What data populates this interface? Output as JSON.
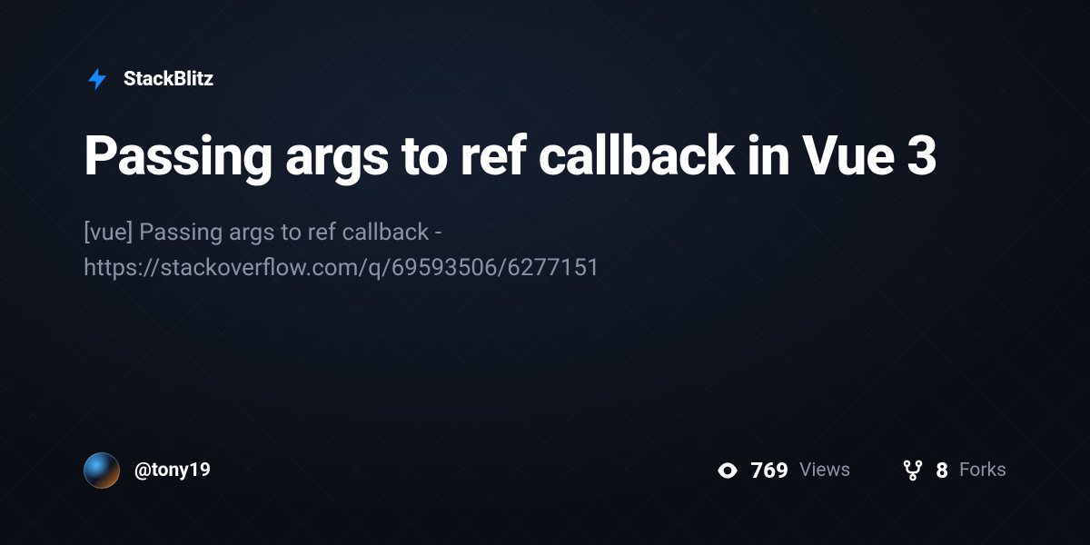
{
  "brand": {
    "name": "StackBlitz"
  },
  "project": {
    "title": "Passing args to ref callback in Vue 3",
    "description": "[vue] Passing args to ref callback - https://stackoverflow.com/q/69593506/6277151"
  },
  "author": {
    "username": "@tony19"
  },
  "stats": {
    "views": {
      "count": "769",
      "label": "Views"
    },
    "forks": {
      "count": "8",
      "label": "Forks"
    }
  }
}
